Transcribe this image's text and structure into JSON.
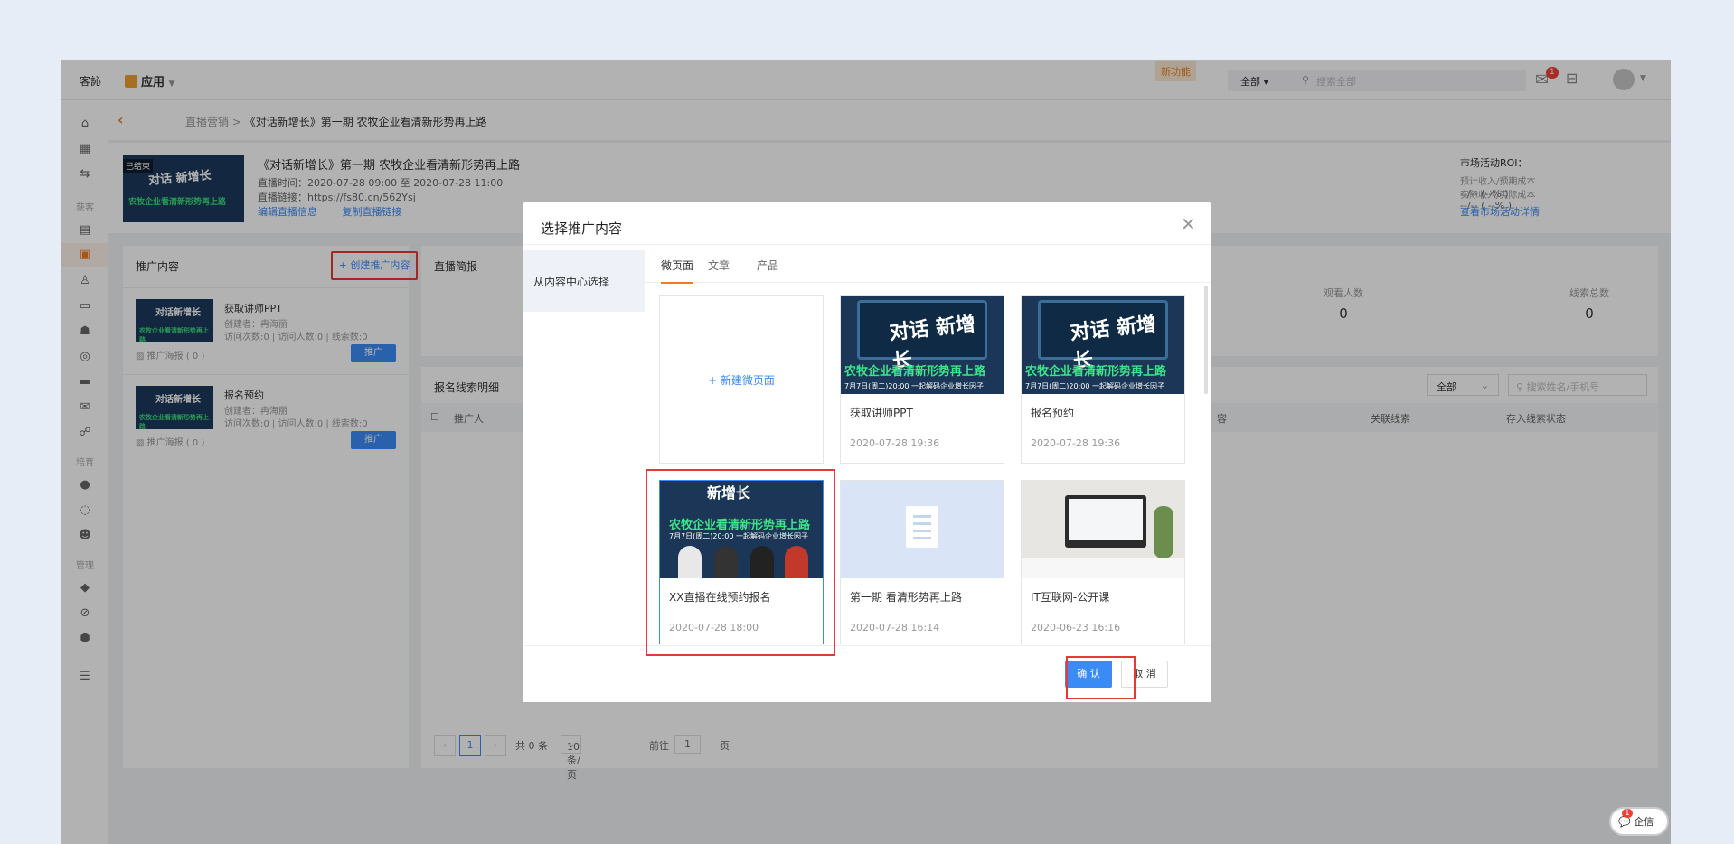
{
  "topbar": {
    "tenant": "客訫",
    "app": "应用",
    "new_feature": "新功能",
    "search_scope": "全部",
    "search_placeholder": "搜索全部",
    "mail_badge": "1"
  },
  "breadcrumb": {
    "parent": "直播营销",
    "current": "《对话新增长》第一期 农牧企业看清新形势再上路"
  },
  "header": {
    "cover_tag": "已结束",
    "cover_title": "对话 新增长",
    "cover_sub": "农牧企业看清新形势再上路",
    "title": "《对话新增长》第一期 农牧企业看清新形势再上路",
    "time": "直播时间：2020-07-28 09:00 至 2020-07-28 11:00",
    "link": "直播链接：https://fs80.cn/562Ysj",
    "edit_link": "编辑直播信息",
    "copy_link": "复制直播链接",
    "roi_label": "市场活动ROI：",
    "roi_col1": "预计收入/预期成本",
    "roi_col2": "实际收入/实际成本",
    "roi_val1": "--/-- (--% )",
    "roi_val2": "--/-- ( --% )",
    "roi_detail": "查看市场活动详情"
  },
  "sidebar": {
    "section_acquire": "获客",
    "section_nurture": "培育",
    "section_manage": "管理"
  },
  "left_panel": {
    "title": "推广内容",
    "create": "+ 创建推广内容",
    "items": [
      {
        "name": "获取讲师PPT",
        "creator": "创建者：冉海丽",
        "stats": "访问次数:0 | 访问人数:0 | 线索数:0",
        "poster": "推广海报 ( 0 )",
        "btn": "推广"
      },
      {
        "name": "报名预约",
        "creator": "创建者：冉海丽",
        "stats": "访问次数:0 | 访问人数:0 | 线索数:0",
        "poster": "推广海报 ( 0 )",
        "btn": "推广"
      }
    ]
  },
  "brief": {
    "title": "直播简报",
    "stats": [
      {
        "label": "观看人数",
        "value": "0"
      },
      {
        "label": "线索总数",
        "value": "0"
      }
    ]
  },
  "leads": {
    "title": "报名线索明细",
    "filter": "全部",
    "search_placeholder": "搜索姓名/手机号",
    "col_promoter": "推广人",
    "col_content": "容",
    "col_related": "关联线索",
    "col_status": "存入线索状态"
  },
  "pager": {
    "page": "1",
    "total": "共 0 条",
    "size": "10条/页",
    "goto": "前往",
    "goto_page": "1",
    "goto_unit": "页"
  },
  "qixin": {
    "label": "企信",
    "badge": "1"
  },
  "modal": {
    "title": "选择推广内容",
    "source": "从内容中心选择",
    "tabs": [
      "微页面",
      "文章",
      "产品"
    ],
    "new_page": "+ 新建微页面",
    "cards": [
      {
        "name": "获取讲师PPT",
        "date": "2020-07-28 19:36"
      },
      {
        "name": "报名预约",
        "date": "2020-07-28 19:36"
      },
      {
        "name": "XX直播在线预约报名",
        "date": "2020-07-28 18:00"
      },
      {
        "name": "第一期 看清形势再上路",
        "date": "2020-07-28 16:14"
      },
      {
        "name": "IT互联网-公开课",
        "date": "2020-06-23 16:16"
      }
    ],
    "poster_title": "对话 新增长",
    "poster_bar": "农牧企业看清新形势再上路",
    "poster_sub": "7月7日(周二)20:00 一起解码企业增长因子",
    "poster2_title": "新增长",
    "confirm": "确 认",
    "cancel": "取 消"
  }
}
